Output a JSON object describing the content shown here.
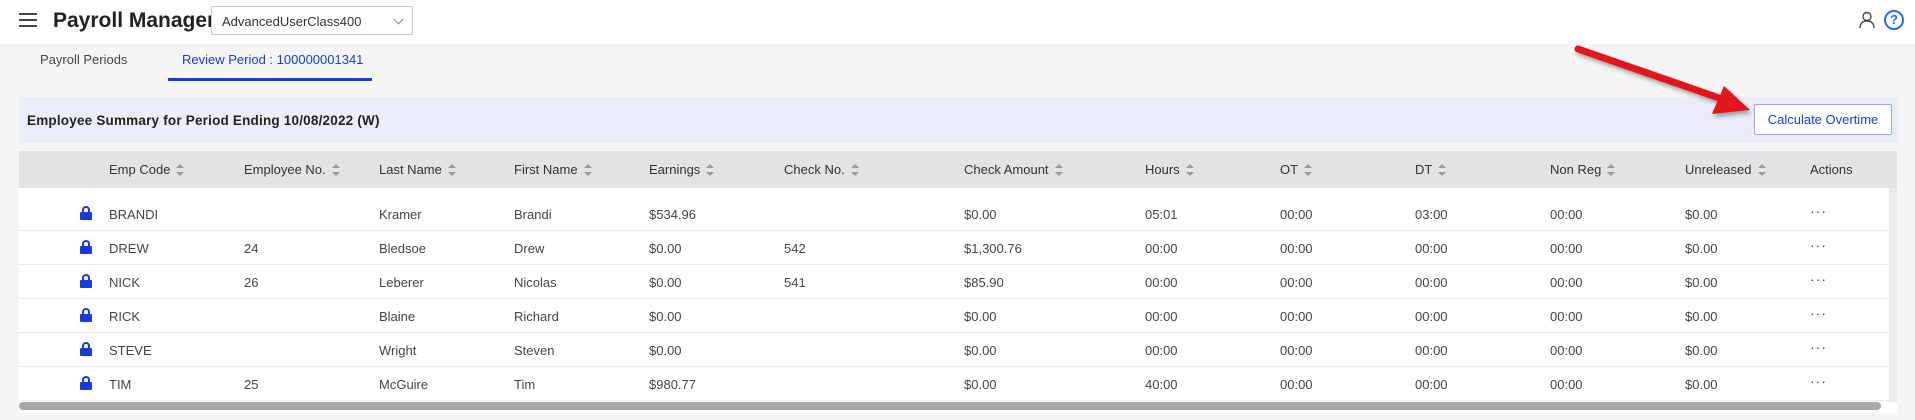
{
  "header": {
    "title": "Payroll Manager",
    "class_select": "AdvancedUserClass400",
    "help_glyph": "?"
  },
  "tabs": [
    {
      "label": "Payroll Periods",
      "active": false
    },
    {
      "label": "Review Period : 100000001341",
      "active": true
    }
  ],
  "summary": {
    "title": "Employee Summary for Period Ending 10/08/2022 (W)",
    "calculate_button": "Calculate Overtime"
  },
  "table": {
    "columns": [
      "Emp Code",
      "Employee No.",
      "Last Name",
      "First Name",
      "Earnings",
      "Check No.",
      "Check Amount",
      "Hours",
      "OT",
      "DT",
      "Non Reg",
      "Unreleased",
      "Actions"
    ],
    "rows": [
      {
        "emp_code": "BRANDI",
        "employee_no": "",
        "last_name": "Kramer",
        "first_name": "Brandi",
        "earnings": "$534.96",
        "check_no": "",
        "check_amount": "$0.00",
        "hours": "05:01",
        "ot": "00:00",
        "dt": "03:00",
        "non_reg": "00:00",
        "unreleased": "$0.00",
        "actions": "···"
      },
      {
        "emp_code": "DREW",
        "employee_no": "24",
        "last_name": "Bledsoe",
        "first_name": "Drew",
        "earnings": "$0.00",
        "check_no": "542",
        "check_amount": "$1,300.76",
        "hours": "00:00",
        "ot": "00:00",
        "dt": "00:00",
        "non_reg": "00:00",
        "unreleased": "$0.00",
        "actions": "···"
      },
      {
        "emp_code": "NICK",
        "employee_no": "26",
        "last_name": "Leberer",
        "first_name": "Nicolas",
        "earnings": "$0.00",
        "check_no": "541",
        "check_amount": "$85.90",
        "hours": "00:00",
        "ot": "00:00",
        "dt": "00:00",
        "non_reg": "00:00",
        "unreleased": "$0.00",
        "actions": "···"
      },
      {
        "emp_code": "RICK",
        "employee_no": "",
        "last_name": "Blaine",
        "first_name": "Richard",
        "earnings": "$0.00",
        "check_no": "",
        "check_amount": "$0.00",
        "hours": "00:00",
        "ot": "00:00",
        "dt": "00:00",
        "non_reg": "00:00",
        "unreleased": "$0.00",
        "actions": "···"
      },
      {
        "emp_code": "STEVE",
        "employee_no": "",
        "last_name": "Wright",
        "first_name": "Steven",
        "earnings": "$0.00",
        "check_no": "",
        "check_amount": "$0.00",
        "hours": "00:00",
        "ot": "00:00",
        "dt": "00:00",
        "non_reg": "00:00",
        "unreleased": "$0.00",
        "actions": "···"
      },
      {
        "emp_code": "TIM",
        "employee_no": "25",
        "last_name": "McGuire",
        "first_name": "Tim",
        "earnings": "$980.77",
        "check_no": "",
        "check_amount": "$0.00",
        "hours": "40:00",
        "ot": "00:00",
        "dt": "00:00",
        "non_reg": "00:00",
        "unreleased": "$0.00",
        "actions": "···"
      }
    ]
  },
  "icons": {
    "menu": "hamburger-menu-icon",
    "user": "user-icon",
    "help": "help-icon",
    "row_lock": "lock-icon",
    "annotation": "red-arrow-icon"
  },
  "colors": {
    "accent": "#1a3bd8",
    "summary_bg": "#e9eefa",
    "header_row_bg": "#e3e3e3",
    "annotation_arrow": "#e0181b"
  }
}
